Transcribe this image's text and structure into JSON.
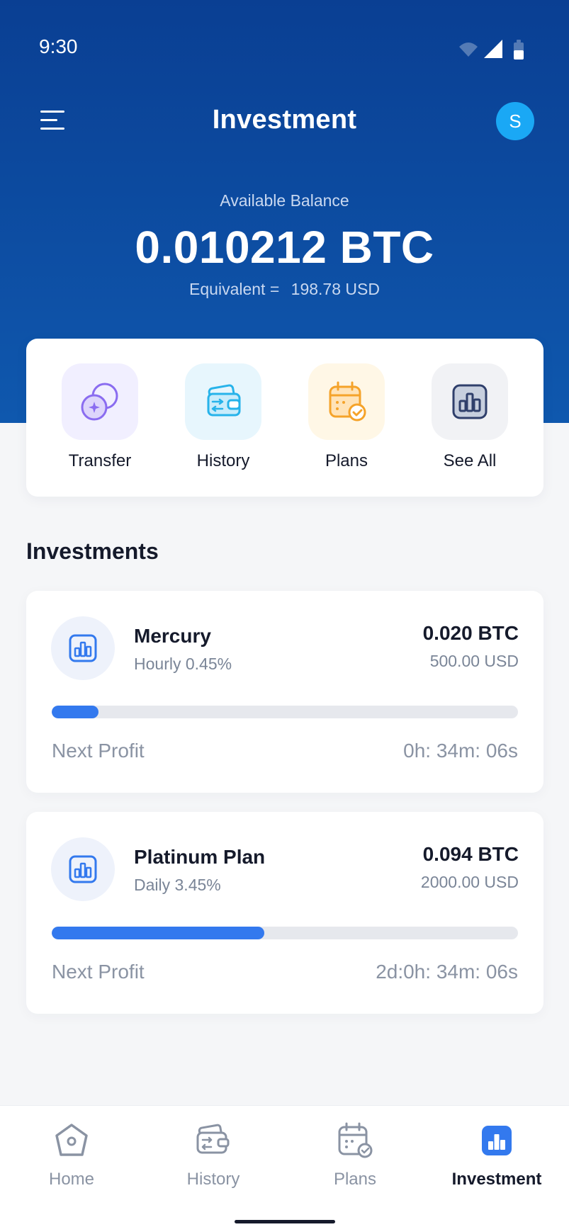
{
  "status_bar": {
    "time": "9:30"
  },
  "header": {
    "title": "Investment",
    "avatar_initial": "S"
  },
  "balance": {
    "label": "Available Balance",
    "value": "0.010212 BTC",
    "equivalent_label": "Equivalent =",
    "equivalent_value": "198.78 USD"
  },
  "quick_actions": [
    {
      "label": "Transfer",
      "icon": "transfer-coins-icon",
      "bg": "#f1efff"
    },
    {
      "label": "History",
      "icon": "wallet-history-icon",
      "bg": "#e7f6fd"
    },
    {
      "label": "Plans",
      "icon": "calendar-check-icon",
      "bg": "#fff7e6"
    },
    {
      "label": "See All",
      "icon": "chart-box-icon",
      "bg": "#f1f2f5"
    }
  ],
  "investments_title": "Investments",
  "investments": [
    {
      "name": "Mercury",
      "rate": "Hourly 0.45%",
      "btc": "0.020 BTC",
      "usd": "500.00 USD",
      "progress": 0.1,
      "next_label": "Next Profit",
      "next_time": "0h: 34m: 06s"
    },
    {
      "name": "Platinum Plan",
      "rate": "Daily 3.45%",
      "btc": "0.094 BTC",
      "usd": "2000.00 USD",
      "progress": 0.456,
      "next_label": "Next Profit",
      "next_time": "2d:0h: 34m: 06s"
    }
  ],
  "tabbar": [
    {
      "label": "Home",
      "icon": "home-icon",
      "active": false
    },
    {
      "label": "History",
      "icon": "wallet-history-icon",
      "active": false
    },
    {
      "label": "Plans",
      "icon": "calendar-check-icon",
      "active": false
    },
    {
      "label": "Investment",
      "icon": "investment-chart-icon",
      "active": true
    }
  ],
  "colors": {
    "header_gradient_top": "#0a3f93",
    "header_gradient_bottom": "#0f58ae",
    "accent": "#3379ee",
    "avatar": "#1aa8f5",
    "background": "#f5f6f8"
  }
}
